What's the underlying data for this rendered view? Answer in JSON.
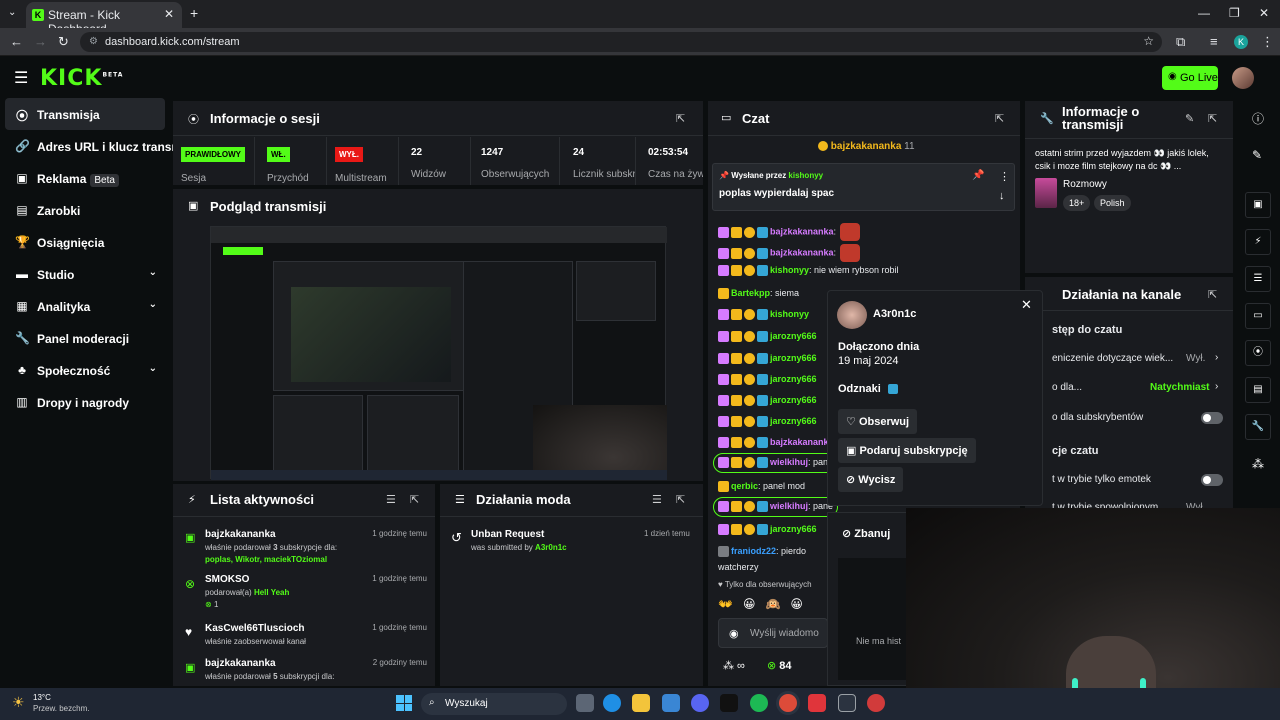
{
  "browser": {
    "tab_title": "Stream - Kick Dashboard",
    "url": "dashboard.kick.com/stream",
    "profile_initial": "K"
  },
  "header": {
    "logo": "KICK",
    "logo_sup": "BETA",
    "go_live": "Go Live"
  },
  "sidebar": {
    "items": [
      {
        "label": "Transmisja",
        "icon": "broadcast-icon"
      },
      {
        "label": "Adres URL i klucz transmisji",
        "icon": "link-icon"
      },
      {
        "label": "Reklama",
        "badge": "Beta",
        "icon": "ad-icon"
      },
      {
        "label": "Zarobki",
        "icon": "chart-icon"
      },
      {
        "label": "Osiągnięcia",
        "icon": "trophy-icon"
      },
      {
        "label": "Studio",
        "icon": "studio-icon"
      },
      {
        "label": "Analityka",
        "icon": "analytics-icon"
      },
      {
        "label": "Panel moderacji",
        "icon": "wrench-icon"
      },
      {
        "label": "Społeczność",
        "icon": "community-icon"
      },
      {
        "label": "Dropy i nagrody",
        "icon": "gift-icon"
      }
    ]
  },
  "session": {
    "title": "Informacje o sesji",
    "cells": [
      {
        "tag": "PRAWIDŁOWY",
        "label": "Sesja"
      },
      {
        "tag": "WŁ.",
        "label": "Przychód"
      },
      {
        "tag": "WYŁ.",
        "label": "Multistream"
      },
      {
        "value": "22",
        "label": "Widzów"
      },
      {
        "value": "1247",
        "label": "Obserwujących"
      },
      {
        "value": "24",
        "label": "Licznik subskrypcji"
      },
      {
        "value": "02:53:54",
        "label": "Czas na żywo"
      }
    ]
  },
  "preview": {
    "title": "Podgląd transmisji"
  },
  "activity": {
    "title": "Lista aktywności",
    "items": [
      {
        "name": "bajzkakananka",
        "time": "1 godzinę temu",
        "line1": "właśnie podarował",
        "count": "3",
        "line1b": "subskrypcje dla:",
        "line2": "poplas, Wikotr, maciekTOziomal"
      },
      {
        "name": "SMOKSO",
        "time": "1 godzinę temu",
        "line1": "podarował(a)",
        "highlight": "Hell Yeah",
        "amount": "1"
      },
      {
        "name": "KasCwel66Tluscioch",
        "time": "1 godzinę temu",
        "line1": "właśnie zaobserwował kanał"
      },
      {
        "name": "bajzkakananka",
        "time": "2 godziny temu",
        "line1": "właśnie podarował",
        "count": "5",
        "line1b": "subskrypcji dla:"
      }
    ]
  },
  "mod": {
    "title": "Działania moda",
    "item_title": "Unban Request",
    "item_sub": "was submitted by",
    "item_user": "A3r0n1c",
    "item_time": "1 dzień temu"
  },
  "chat": {
    "title": "Czat",
    "top_user": "bajzkakananka",
    "top_count": "11",
    "pinned_by_label": "Wysłane przez",
    "pinned_user": "kishonyy",
    "pinned_msg": "poplas wypierdalaj spac",
    "messages": [
      {
        "user": "bajzkakananka",
        "text": ":",
        "color": "#d67bff"
      },
      {
        "user": "bajzkakananka",
        "text": ":",
        "color": "#d67bff"
      },
      {
        "user": "kishonyy",
        "text": ": nie wiem rybson robil",
        "color": "#53fc18"
      },
      {
        "user": "Bartekpp",
        "text": ": siema",
        "color": "#53fc18"
      },
      {
        "user": "kishonyy",
        "text": "",
        "color": "#53fc18"
      },
      {
        "user": "jarozny666",
        "text": "",
        "color": "#53fc18"
      },
      {
        "user": "jarozny666",
        "text": "",
        "color": "#53fc18"
      },
      {
        "user": "jarozny666",
        "text": "",
        "color": "#53fc18"
      },
      {
        "user": "jarozny666",
        "text": "",
        "color": "#53fc18"
      },
      {
        "user": "jarozny666",
        "text": "",
        "color": "#53fc18"
      },
      {
        "user": "bajzkakananka",
        "text": "",
        "color": "#d67bff"
      },
      {
        "user": "wielkihuj",
        "text": ": pane",
        "color": "#d67bff"
      },
      {
        "user": "qerbic",
        "text": ": panel mod",
        "color": "#53fc18"
      },
      {
        "user": "wielkihuj",
        "text": ": pane",
        "color": "#d67bff"
      },
      {
        "user": "jarozny666",
        "text": "",
        "color": "#53fc18"
      },
      {
        "user": "franiodz22",
        "text": ": pierdo",
        "color": "#3aa0ff"
      }
    ],
    "wrap_line": "watcherzy",
    "followers_only": "Tylko dla obserwujących",
    "input_placeholder": "Wyślij wiadomo",
    "points": "84"
  },
  "popup": {
    "username": "A3r0n1c",
    "joined_label": "Dołączono dnia",
    "joined_date": "19 maj 2024",
    "badges_label": "Odznaki",
    "follow": "Obserwuj",
    "gift": "Podaruj subskrypcję",
    "mute": "Wycisz",
    "ban": "Zbanuj",
    "no_history": "Nie ma hist"
  },
  "stream_info": {
    "title": "Informacje o transmisji",
    "description": "ostatni strim przed wyjazdem 👀 jakiś lolek, csik i moze film stejkowy na dc 👀 ...",
    "category": "Rozmowy",
    "tags": [
      "18+",
      "Polish"
    ]
  },
  "channel_actions": {
    "title": "Działania na kanale",
    "access_title": "stęp do czatu",
    "rows": [
      {
        "label": "eniczenie dotyczące wiek...",
        "value": "Wył."
      },
      {
        "label": "o dla...",
        "value": "Natychmiast"
      },
      {
        "label": "o dla subskrybentów",
        "toggle": true
      }
    ],
    "settings_title": "cje czatu",
    "rows2": [
      {
        "label": "t w trybie tylko emotek",
        "toggle": true
      },
      {
        "label": "t w trybie spowolnionym",
        "value": "Wył."
      }
    ]
  },
  "taskbar": {
    "weather_temp": "13°C",
    "weather_desc": "Przew. bezchm.",
    "search": "Wyszukaj"
  }
}
